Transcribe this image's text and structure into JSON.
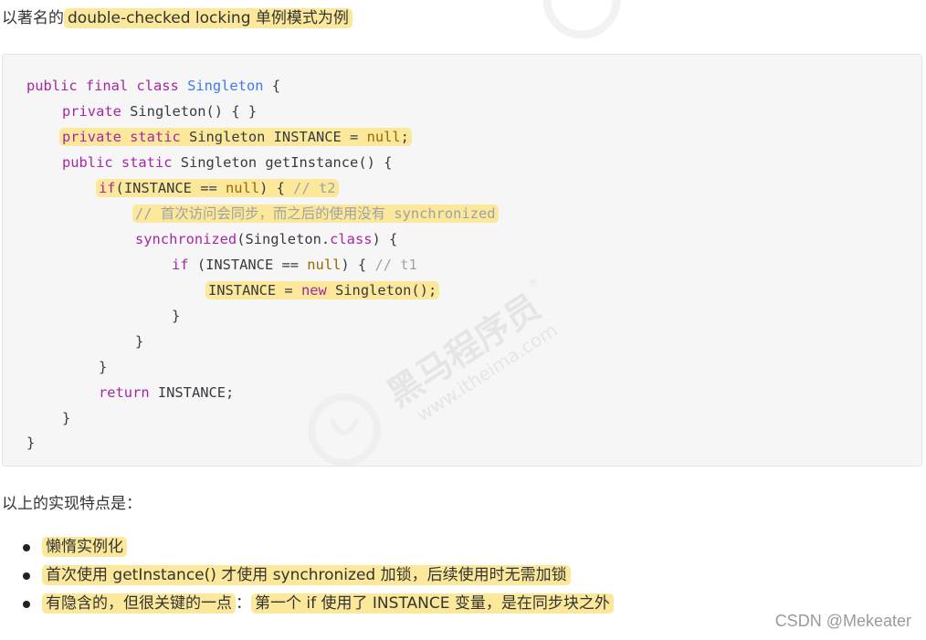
{
  "intro": {
    "prefix": "以著名的",
    "highlight": "double-checked locking 单例模式为例"
  },
  "code": {
    "l1": {
      "kw": "public final class",
      "name": "Singleton",
      "rest": " {"
    },
    "l2": {
      "kw": "private",
      "rest": " Singleton() { }"
    },
    "l3": {
      "kw": "private static",
      "rest": " Singleton INSTANCE = ",
      "lit": "null",
      "end": ";"
    },
    "l4": {
      "kw": "public static",
      "rest": " Singleton getInstance() {"
    },
    "l5": {
      "kw": "if",
      "rest": "(INSTANCE == ",
      "lit": "null",
      "rest2": ") { ",
      "comment": "// t2"
    },
    "l6": {
      "comment": "// 首次访问会同步，而之后的使用没有 synchronized"
    },
    "l7": {
      "kw": "synchronized",
      "rest": "(Singleton.",
      "kw2": "class",
      "rest2": ") {"
    },
    "l8": {
      "kw": "if",
      "rest": " (INSTANCE == ",
      "lit": "null",
      "rest2": ") { ",
      "comment": "// t1"
    },
    "l9": {
      "rest": "INSTANCE = ",
      "kw": "new",
      "rest2": " Singleton();"
    },
    "l10": {
      "text": "}"
    },
    "l11": {
      "text": "}"
    },
    "l12": {
      "text": "}"
    },
    "l13": {
      "kw": "return",
      "rest": " INSTANCE;"
    },
    "l14": {
      "text": "}"
    },
    "l15": {
      "text": "}"
    }
  },
  "features_heading": "以上的实现特点是：",
  "bullets": [
    {
      "text": "懒惰实例化"
    },
    {
      "text": "首次使用 getInstance() 才使用 synchronized 加锁，后续使用时无需加锁"
    },
    {
      "part1": "有隐含的，但很关键的一点",
      "sep": "：",
      "part2": "第一个 if 使用了 INSTANCE 变量，是在同步块之外"
    }
  ],
  "watermark": {
    "brand": "黑马程序员",
    "url": "www.itheima.com",
    "mark": "®"
  },
  "source_credit": "CSDN @Mekeater",
  "colors": {
    "highlight": "#fbe89a",
    "code_background": "#f6f6f6",
    "keyword": "#a626a4",
    "class_name": "#4078f2",
    "literal": "#986801",
    "comment": "#a0a1a7"
  }
}
